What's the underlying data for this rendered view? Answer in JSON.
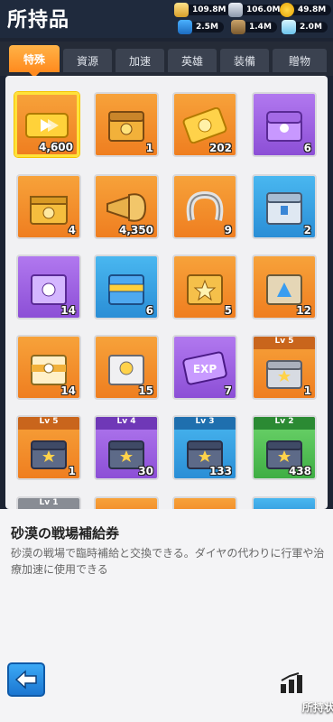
{
  "header": {
    "title": "所持品",
    "resources_top": [
      {
        "icon": "gold-bar-icon",
        "value": "109.8M"
      },
      {
        "icon": "steel-icon",
        "value": "106.0M"
      },
      {
        "icon": "coin-icon",
        "value": "49.8M"
      }
    ],
    "resources_bottom": [
      {
        "icon": "oil-barrel-icon",
        "value": "2.5M"
      },
      {
        "icon": "shell-icon",
        "value": "1.4M"
      },
      {
        "icon": "gem-icon",
        "value": "2.0M"
      }
    ]
  },
  "tabs": [
    {
      "label": "特殊",
      "active": true
    },
    {
      "label": "資源"
    },
    {
      "label": "加速"
    },
    {
      "label": "英雄"
    },
    {
      "label": "装備"
    },
    {
      "label": "贈物"
    }
  ],
  "items": [
    {
      "icon": "ticket-icon",
      "count": "4,600",
      "color": "orange"
    },
    {
      "icon": "key-chest-icon",
      "count": "1",
      "color": "orange"
    },
    {
      "icon": "gold-ticket-icon",
      "count": "202",
      "color": "orange"
    },
    {
      "icon": "purple-chest-icon",
      "count": "6",
      "color": "purple"
    },
    {
      "icon": "gold-crate-icon",
      "count": "4",
      "color": "orange"
    },
    {
      "icon": "horn-icon",
      "count": "4,350",
      "color": "orange"
    },
    {
      "icon": "horseshoe-icon",
      "count": "9",
      "color": "orange"
    },
    {
      "icon": "blue-chest-icon",
      "count": "2",
      "color": "blue"
    },
    {
      "icon": "purple-box-icon",
      "count": "14",
      "color": "purple"
    },
    {
      "icon": "blue-box-icon",
      "count": "6",
      "color": "blue"
    },
    {
      "icon": "star-crate-icon",
      "count": "5",
      "color": "orange"
    },
    {
      "icon": "triangle-crate-icon",
      "count": "12",
      "color": "orange"
    },
    {
      "icon": "gold-box-icon",
      "count": "14",
      "color": "orange"
    },
    {
      "icon": "silver-box-icon",
      "count": "15",
      "color": "orange"
    },
    {
      "icon": "exp-card-icon",
      "count": "7",
      "color": "purple"
    },
    {
      "icon": "lv-chest-icon",
      "count": "1",
      "color": "orange",
      "level": "Lv 5"
    },
    {
      "icon": "lv-chest-icon",
      "count": "1",
      "color": "orange",
      "level": "Lv 5"
    },
    {
      "icon": "lv-chest-icon",
      "count": "30",
      "color": "purple",
      "level": "Lv 4"
    },
    {
      "icon": "lv-chest-icon",
      "count": "133",
      "color": "blue",
      "level": "Lv 3"
    },
    {
      "icon": "lv-chest-icon",
      "count": "438",
      "color": "green",
      "level": "Lv 2"
    }
  ],
  "partial_row_level": "Lv 1",
  "description": {
    "title": "砂漠の戦場補給券",
    "text": "砂漠の戦場で臨時補給と交換できる。ダイヤの代わりに行軍や治療加速に使用できる"
  },
  "footer": {
    "status_label": "所持状況"
  },
  "colors": {
    "orange": "#f39233",
    "purple": "#a066e6",
    "blue": "#3aa5e8",
    "green": "#56c456",
    "selected": "#ffe23a"
  }
}
